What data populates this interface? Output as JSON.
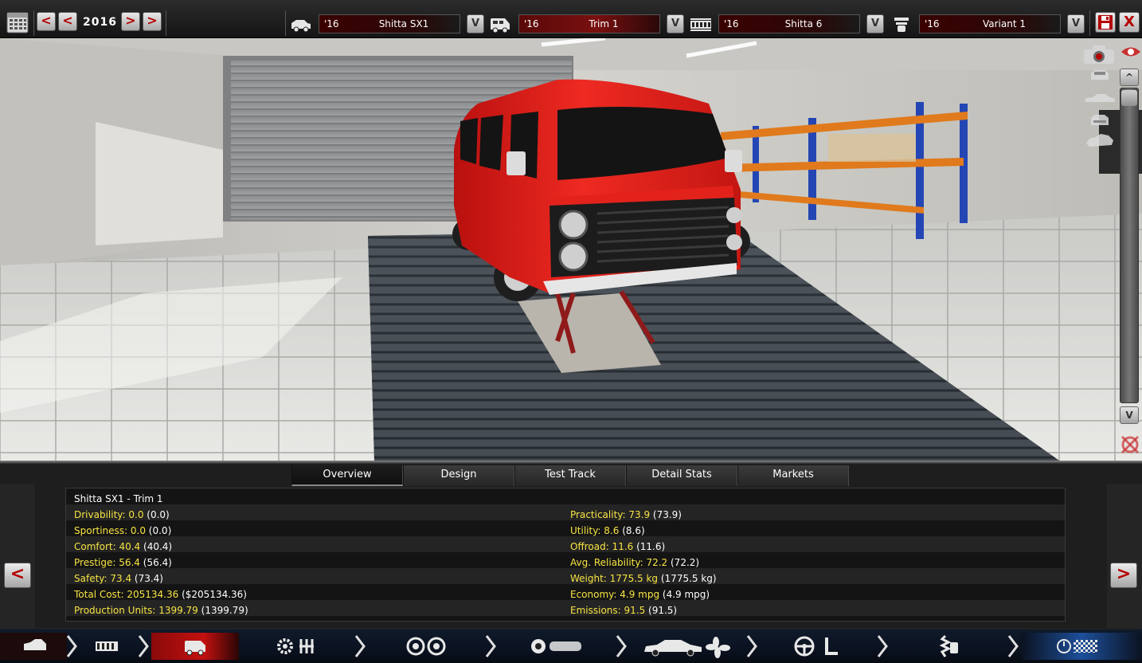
{
  "topbar": {
    "year": "2016",
    "prev_fast": "<",
    "prev": "<",
    "next": ">",
    "next_fast": ">",
    "dropdown_arrow": "V",
    "selectors": [
      {
        "icon": "car-model-icon",
        "year": "'16",
        "name": "Shitta SX1"
      },
      {
        "icon": "car-trim-icon",
        "year": "'16",
        "name": "Trim 1"
      },
      {
        "icon": "engine-family-icon",
        "year": "'16",
        "name": "Shitta 6"
      },
      {
        "icon": "engine-variant-icon",
        "year": "'16",
        "name": "Variant 1"
      }
    ],
    "close_label": "X"
  },
  "viewport": {
    "scroll_up": "^",
    "scroll_down": "V"
  },
  "tabs": [
    "Overview",
    "Design",
    "Test Track",
    "Detail Stats",
    "Markets"
  ],
  "active_tab": "Overview",
  "panel": {
    "prev_label": "<",
    "next_label": ">"
  },
  "stats": {
    "title": "Shitta SX1 - Trim 1",
    "left": [
      {
        "key": "Drivability: 0.0",
        "val": " (0.0)"
      },
      {
        "key": "Sportiness: 0.0",
        "val": " (0.0)"
      },
      {
        "key": "Comfort: 40.4",
        "val": " (40.4)"
      },
      {
        "key": "Prestige: 56.4",
        "val": " (56.4)"
      },
      {
        "key": "Safety: 73.4",
        "val": " (73.4)"
      },
      {
        "key": "Total Cost: 205134.36",
        "val": " ($205134.36)"
      },
      {
        "key": "Production Units: 1399.79",
        "val": " (1399.79)"
      }
    ],
    "right": [
      {
        "key": "Practicality: 73.9",
        "val": " (73.9)"
      },
      {
        "key": "Utility: 8.6",
        "val": " (8.6)"
      },
      {
        "key": "Offroad: 11.6",
        "val": " (11.6)"
      },
      {
        "key": "Avg. Reliability: 72.2",
        "val": " (72.2)"
      },
      {
        "key": "Weight: 1775.5 kg",
        "val": " (1775.5 kg)"
      },
      {
        "key": "Economy: 4.9 mpg",
        "val": " (4.9 mpg)"
      },
      {
        "key": "Emissions: 91.5",
        "val": " (91.5)"
      }
    ]
  },
  "bottom_nav": [
    "car-body-step-icon",
    "engine-block-step-icon",
    "trim-step-icon",
    "engine-design-step-icon",
    "wheels-step-icon",
    "drivetrain-step-icon",
    "aero-cooling-step-icon",
    "interior-step-icon",
    "suspension-step-icon",
    "final-step-icon"
  ],
  "colors": {
    "accent_red": "#b40000",
    "stat_key": "#f7e443",
    "car_body": "#e81f1a"
  }
}
